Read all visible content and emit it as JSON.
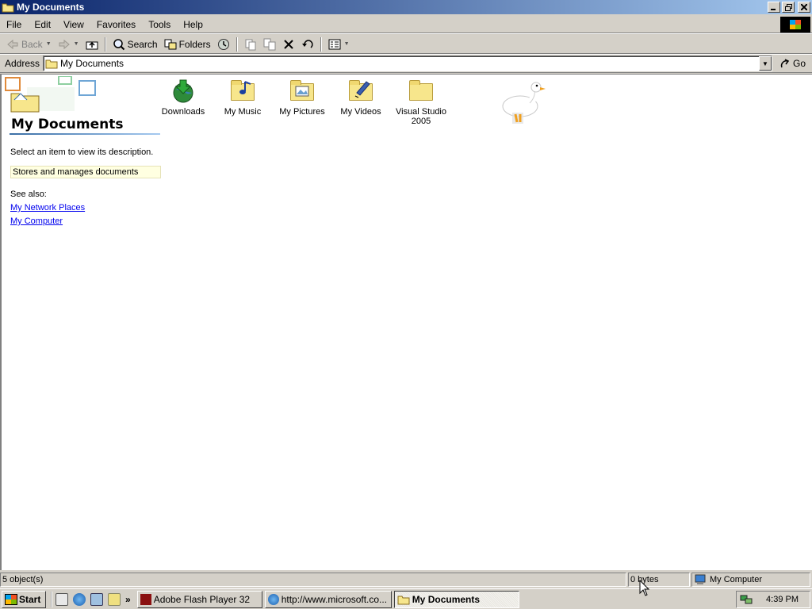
{
  "window": {
    "title": "My Documents"
  },
  "menubar": {
    "items": [
      "File",
      "Edit",
      "View",
      "Favorites",
      "Tools",
      "Help"
    ]
  },
  "toolbar": {
    "back": "Back",
    "search": "Search",
    "folders": "Folders"
  },
  "address": {
    "label": "Address",
    "value": "My Documents",
    "go": "Go"
  },
  "webview": {
    "title": "My Documents",
    "prompt": "Select an item to view its description.",
    "description": "Stores and manages documents",
    "see_also": "See also:",
    "links": [
      "My Network Places",
      "My Computer"
    ]
  },
  "files": [
    {
      "label": "Downloads",
      "icon": "downloads-globe-icon"
    },
    {
      "label": "My Music",
      "icon": "music-folder-icon"
    },
    {
      "label": "My Pictures",
      "icon": "pictures-folder-icon"
    },
    {
      "label": "My Videos",
      "icon": "videos-folder-icon"
    },
    {
      "label": "Visual Studio 2005",
      "icon": "folder-icon"
    }
  ],
  "statusbar": {
    "objects": "5 object(s)",
    "size": "0 bytes",
    "zone": "My Computer"
  },
  "taskbar": {
    "start": "Start",
    "tasks": [
      {
        "label": "Adobe Flash Player 32",
        "active": false
      },
      {
        "label": "http://www.microsoft.co...",
        "active": false
      },
      {
        "label": "My Documents",
        "active": true
      }
    ],
    "chevron": "»",
    "clock": "4:39 PM"
  }
}
